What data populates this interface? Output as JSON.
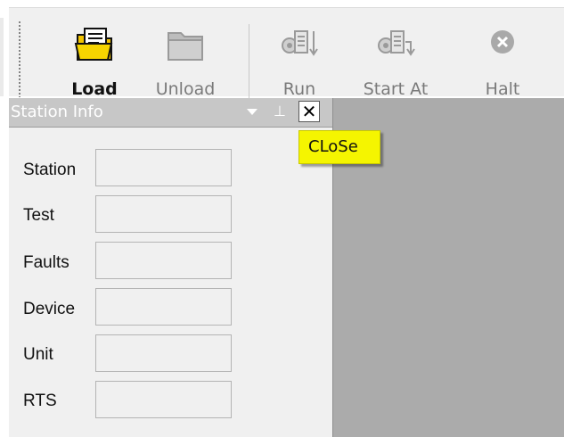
{
  "toolbar": {
    "buttons": [
      {
        "label": "Load",
        "icon": "open-folder-document-icon",
        "enabled": true
      },
      {
        "label": "Unload",
        "icon": "closed-folder-icon",
        "enabled": false
      },
      {
        "label": "Run",
        "icon": "run-icon",
        "enabled": false
      },
      {
        "label": "Start At",
        "icon": "start-at-icon",
        "enabled": false
      },
      {
        "label": "Halt",
        "icon": "halt-icon",
        "enabled": false
      }
    ]
  },
  "panel": {
    "title": "Station Info",
    "fields": [
      {
        "label": "Station",
        "value": ""
      },
      {
        "label": "Test",
        "value": ""
      },
      {
        "label": "Faults",
        "value": ""
      },
      {
        "label": "Device",
        "value": ""
      },
      {
        "label": "Unit",
        "value": ""
      },
      {
        "label": "RTS",
        "value": ""
      }
    ]
  },
  "tooltip": {
    "text": "CLoSe"
  },
  "colors": {
    "tooltip_bg": "#f5f500",
    "main_area_bg": "#ababab",
    "panel_header_bg": "#c7c7c7"
  }
}
